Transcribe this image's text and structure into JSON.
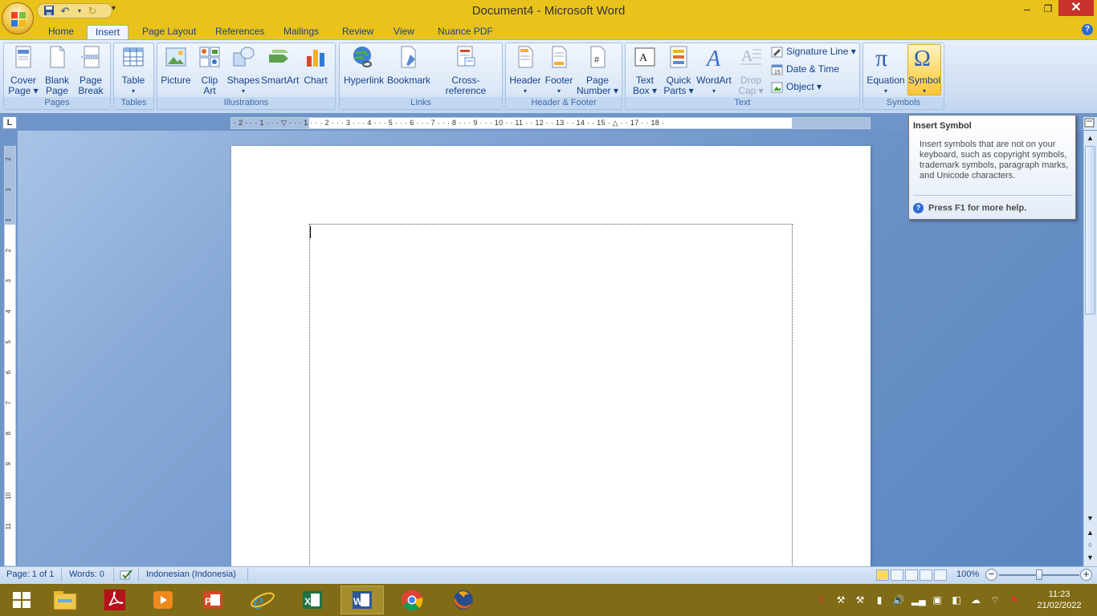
{
  "window": {
    "title": "Document4 - Microsoft Word"
  },
  "window_controls": {
    "minimize": "–",
    "maximize": "❐",
    "close": "✕"
  },
  "tabs": [
    "Home",
    "Insert",
    "Page Layout",
    "References",
    "Mailings",
    "Review",
    "View",
    "Nuance PDF"
  ],
  "active_tab": "Insert",
  "ribbon": {
    "groups": {
      "pages": "Pages",
      "tables": "Tables",
      "illustrations": "Illustrations",
      "links": "Links",
      "header_footer": "Header & Footer",
      "text": "Text",
      "symbols": "Symbols"
    },
    "buttons": {
      "cover_page": [
        "Cover",
        "Page ▾"
      ],
      "blank_page": [
        "Blank",
        "Page"
      ],
      "page_break": [
        "Page",
        "Break"
      ],
      "table": [
        "Table",
        "▾"
      ],
      "picture": [
        "Picture",
        ""
      ],
      "clip_art": [
        "Clip",
        "Art"
      ],
      "shapes": [
        "Shapes",
        "▾"
      ],
      "smartart": [
        "SmartArt",
        ""
      ],
      "chart": [
        "Chart",
        ""
      ],
      "hyperlink": [
        "Hyperlink",
        ""
      ],
      "bookmark": [
        "Bookmark",
        ""
      ],
      "cross_reference": [
        "Cross-reference",
        ""
      ],
      "header": [
        "Header",
        "▾"
      ],
      "footer": [
        "Footer",
        "▾"
      ],
      "page_number": [
        "Page",
        "Number ▾"
      ],
      "text_box": [
        "Text",
        "Box ▾"
      ],
      "quick_parts": [
        "Quick",
        "Parts ▾"
      ],
      "wordart": [
        "WordArt",
        "▾"
      ],
      "drop_cap": [
        "Drop",
        "Cap ▾"
      ],
      "equation": [
        "Equation",
        "▾"
      ],
      "symbol": [
        "Symbol",
        "▾"
      ]
    },
    "small_buttons": {
      "signature_line": "Signature Line ▾",
      "date_time": "Date & Time",
      "object": "Object ▾"
    }
  },
  "ruler": {
    "corner": "L",
    "numbers": "· 2 · · · 1 · · · ▽ · · · 1 · · · 2 · · · 3 · · · 4 · · · 5 · · · 6 · · · 7 · · · 8 · · · 9 · · · 10 · · 11 · · 12 · · 13 · · 14 · · 15 · △ · · 17 · · 18 ·",
    "vertical_numbers": [
      "2",
      "1",
      "1",
      "2",
      "3",
      "4",
      "5",
      "6",
      "7",
      "8",
      "9",
      "10",
      "11"
    ]
  },
  "tooltip": {
    "title": "Insert Symbol",
    "body": "Insert symbols that are not on your keyboard, such as copyright symbols, trademark symbols, paragraph marks, and Unicode characters.",
    "help": "Press F1 for more help."
  },
  "status": {
    "page": "Page: 1 of 1",
    "words": "Words: 0",
    "language": "Indonesian (Indonesia)",
    "zoom": "100%",
    "zoom_level_percent": 100
  },
  "taskbar": {
    "apps": [
      "start",
      "file-explorer",
      "adobe-reader",
      "media-player",
      "powerpoint",
      "internet-explorer",
      "excel",
      "word",
      "chrome",
      "firefox"
    ],
    "active_app": "word"
  },
  "clock": {
    "time": "11:23",
    "date": "21/02/2022"
  },
  "colors": {
    "title_bar": "#e9c21c",
    "ribbon": "#dae7f7",
    "taskbar": "#806b16",
    "workspace": "#6f95c8"
  }
}
